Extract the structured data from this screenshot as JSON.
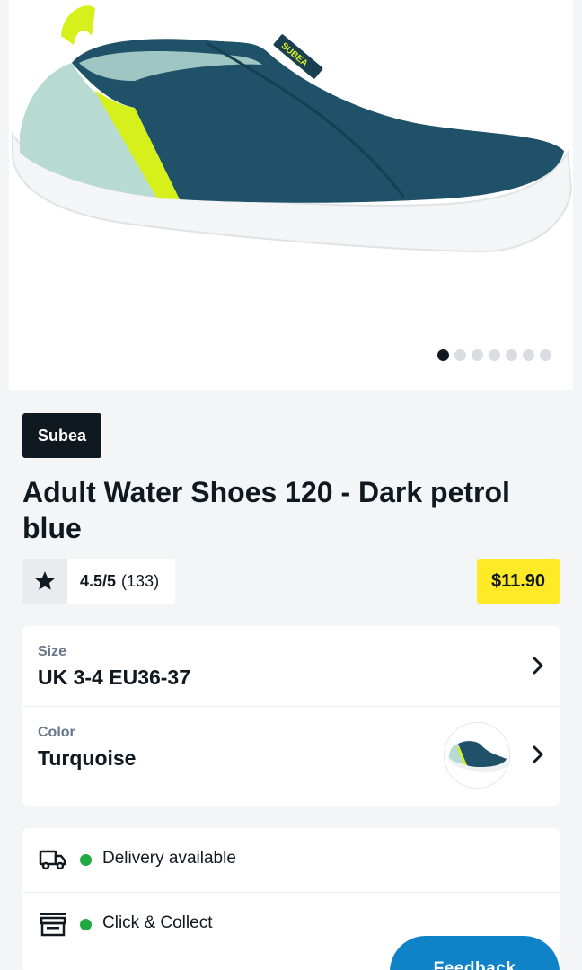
{
  "gallery": {
    "image_alt": "Adult Water Shoes 120 - Dark petrol blue",
    "shoe_brand_print": "SUBEA",
    "dots_total": 7,
    "active_dot": 0
  },
  "product": {
    "brand": "Subea",
    "title": "Adult Water Shoes 120 - Dark petrol blue",
    "rating_score": "4.5/5",
    "rating_count": "(133)",
    "price": "$11.90"
  },
  "options": {
    "size_label": "Size",
    "size_value": "UK 3-4 EU36-37",
    "color_label": "Color",
    "color_value": "Turquoise"
  },
  "availability": {
    "delivery": "Delivery available",
    "collect": "Click & Collect"
  },
  "feedback": {
    "label": "Feedback"
  },
  "colors": {
    "brand_dark": "#101820",
    "price_yellow": "#ffea28",
    "status_green": "#23a942",
    "feedback_blue": "#0f82c8",
    "shoe_petrol": "#1f5168",
    "shoe_lime": "#d6f01c",
    "shoe_mint": "#b7dbd3"
  },
  "icons": [
    "star-icon",
    "chevron-right-icon",
    "delivery-truck-icon",
    "store-icon"
  ]
}
